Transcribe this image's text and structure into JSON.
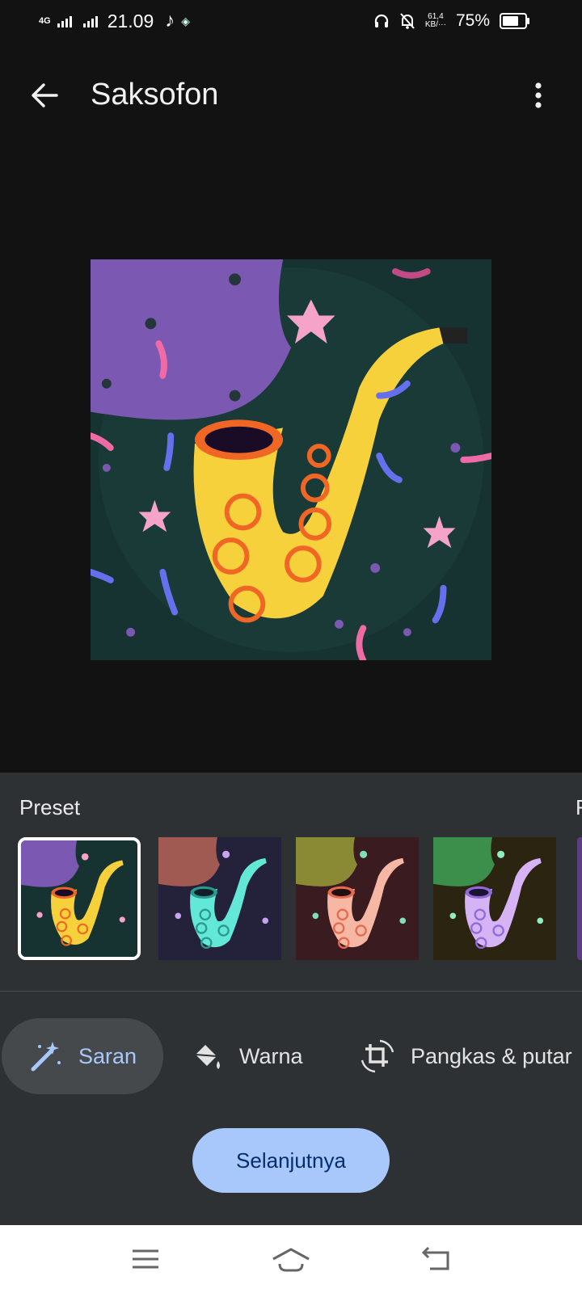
{
  "status_bar": {
    "network": "4G",
    "time": "21.09",
    "data_speed_top": "61,4",
    "data_speed_bottom": "KB/···",
    "battery": "75%",
    "battery_level": 0.75
  },
  "app_bar": {
    "title": "Saksofon",
    "icons": [
      "arrow-back-icon",
      "more-vert-icon"
    ]
  },
  "preset_section": {
    "label": "Preset",
    "next_label_peek": "F",
    "selected_index": 0,
    "thumbnails": [
      {
        "name": "original",
        "colors": {
          "bg": "#173331",
          "upper": "#7b58b2",
          "sax": "#f7d13c",
          "accent": "#f06624"
        }
      },
      {
        "name": "variant-2",
        "colors": {
          "bg": "#24213a",
          "upper": "#a15a52",
          "sax": "#63e8d8",
          "accent": "#2a9a8e"
        }
      },
      {
        "name": "variant-3",
        "colors": {
          "bg": "#3a1b20",
          "upper": "#8b8a34",
          "sax": "#f6b8a5",
          "accent": "#e66a4d"
        }
      },
      {
        "name": "variant-4",
        "colors": {
          "bg": "#2b2410",
          "upper": "#3b8f4b",
          "sax": "#d6b3f5",
          "accent": "#8f6ad8"
        }
      }
    ]
  },
  "tools": [
    {
      "label": "Saran",
      "icon": "magic-wand-icon",
      "active": true
    },
    {
      "label": "Warna",
      "icon": "paint-bucket-icon",
      "active": false
    },
    {
      "label": "Pangkas & putar",
      "icon": "crop-rotate-icon",
      "active": false
    }
  ],
  "next_button": {
    "label": "Selanjutnya"
  },
  "nav_bar": {
    "icons": [
      "menu-icon",
      "home-icon",
      "back-icon"
    ]
  },
  "colors": {
    "background": "#121212",
    "panel": "#2e3133",
    "accent": "#a8c7fa",
    "chip": "#45494c"
  }
}
